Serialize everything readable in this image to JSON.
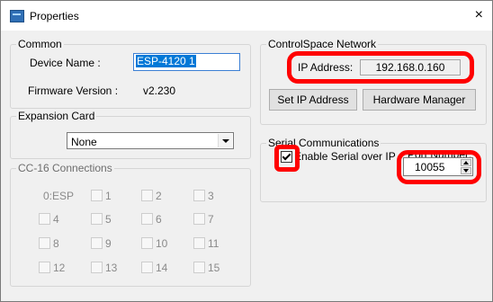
{
  "window": {
    "title": "Properties",
    "close_glyph": "×"
  },
  "common": {
    "title": "Common",
    "device_name_label": "Device Name :",
    "device_name_value": "ESP-4120 1",
    "firmware_label": "Firmware Version :",
    "firmware_value": "v2.230"
  },
  "expansion": {
    "title": "Expansion Card",
    "selected": "None"
  },
  "cc16": {
    "title": "CC-16 Connections",
    "esp_label": "0:ESP",
    "items": [
      "1",
      "2",
      "3",
      "4",
      "5",
      "6",
      "7",
      "8",
      "9",
      "10",
      "11",
      "12",
      "13",
      "14",
      "15"
    ]
  },
  "network": {
    "title": "ControlSpace Network",
    "ip_label": "IP Address:",
    "ip_value": "192.168.0.160",
    "set_ip_button": "Set IP Address",
    "hw_manager_button": "Hardware Manager"
  },
  "serial": {
    "title": "Serial Communications",
    "enable_label": "Enable Serial over IP",
    "enabled": true,
    "port_label": "Port Number:",
    "port_value": "10055"
  },
  "annotation_color": "#ff0000"
}
